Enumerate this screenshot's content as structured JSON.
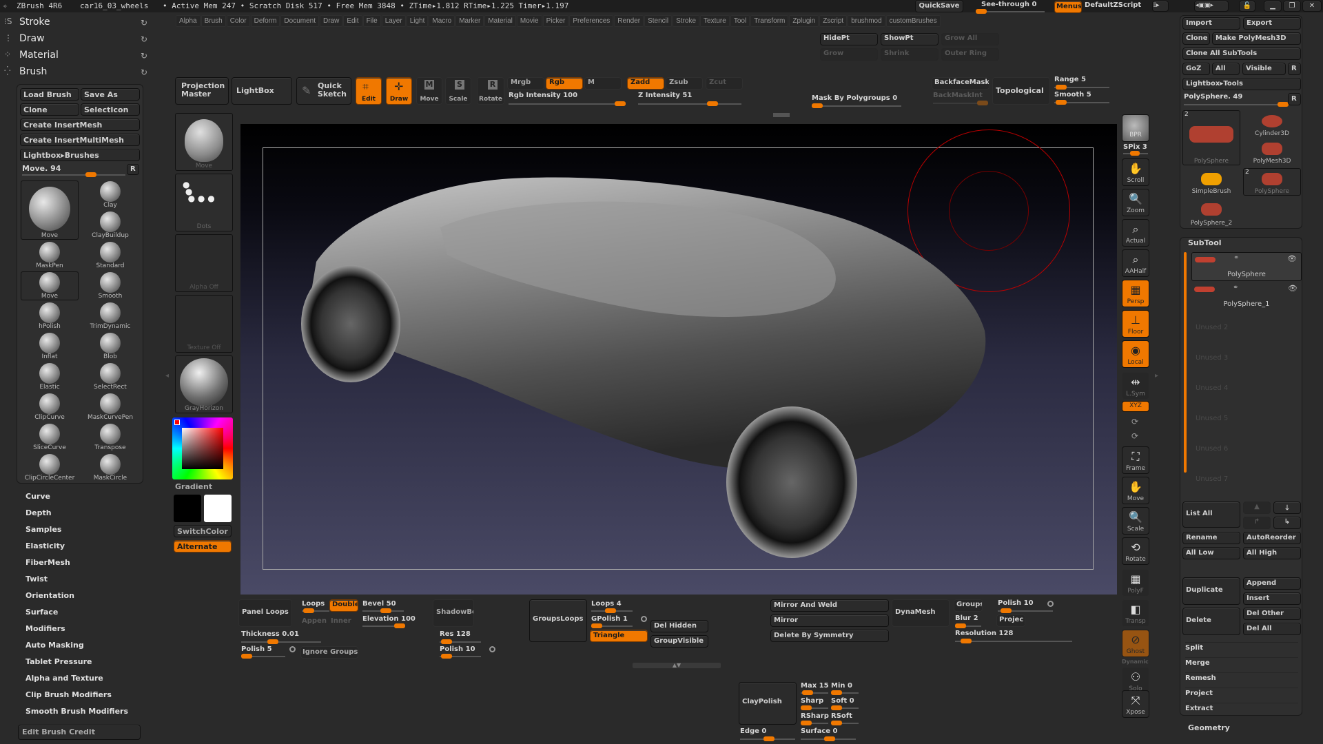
{
  "titlebar": {
    "app": "ZBrush 4R6",
    "document": "car16_03_wheels",
    "stats": "• Active Mem 247 • Scratch Disk 517 • Free Mem 3848 • ZTime▸1.812 RTime▸1.225 Timer▸1.197",
    "quicksave": "QuickSave",
    "see_through": "See-through  0",
    "menus": "Menus",
    "script": "DefaultZScript"
  },
  "menubar": [
    "Alpha",
    "Brush",
    "Color",
    "Deform",
    "Document",
    "Draw",
    "Edit",
    "File",
    "Layer",
    "Light",
    "Macro",
    "Marker",
    "Material",
    "Movie",
    "Picker",
    "Preferences",
    "Render",
    "Stencil",
    "Stroke",
    "Texture",
    "Tool",
    "Transform",
    "Zplugin",
    "Zscript",
    "brushmod",
    "customBrushes"
  ],
  "left_panel": {
    "headers": [
      "Stroke",
      "Draw",
      "Material",
      "Brush"
    ],
    "brush_buttons": {
      "load": "Load Brush",
      "save": "Save As",
      "clone": "Clone",
      "select_icon": "SelectIcon",
      "insert_mesh": "Create InsertMesh",
      "insert_multi": "Create InsertMultiMesh",
      "lightbox": "Lightbox▸Brushes"
    },
    "brush_slider": {
      "label": "Move. 94",
      "reset": "R",
      "value": 94
    },
    "brushes": [
      "Move",
      "Clay",
      "ClayBuildup",
      "MaskPen",
      "Standard",
      "Move",
      "Smooth",
      "hPolish",
      "TrimDynamic",
      "Inflat",
      "Blob",
      "Elastic",
      "SelectRect",
      "ClipCurve",
      "MaskCurvePen",
      "SliceCurve",
      "Transpose",
      "ClipCircleCenter",
      "MaskCircle"
    ],
    "sections": [
      "Curve",
      "Depth",
      "Samples",
      "Elasticity",
      "FiberMesh",
      "Twist",
      "Orientation",
      "Surface",
      "Modifiers",
      "Auto Masking",
      "Tablet Pressure",
      "Alpha and Texture",
      "Clip Brush Modifiers",
      "Smooth Brush Modifiers"
    ],
    "edit_credit": "Edit Brush Credit"
  },
  "shelf": {
    "move": "Move",
    "dots": "Dots",
    "alpha": "Alpha  Off",
    "texture": "Texture  Off",
    "material": "GrayHorizon",
    "gradient": "Gradient",
    "switch_color": "SwitchColor",
    "alternate": "Alternate",
    "main_color": "#ff0000",
    "secondary_color": "#ffffff"
  },
  "top_toolbar": {
    "projection_master": "Projection Master",
    "lightbox": "LightBox",
    "quick_sketch": "Quick Sketch",
    "edit": "Edit",
    "draw": "Draw",
    "move": "Move",
    "scale": "Scale",
    "rotate": "Rotate",
    "mrgb": "Mrgb",
    "rgb": "Rgb",
    "m": "M",
    "zadd": "Zadd",
    "zsub": "Zsub",
    "zcut": "Zcut",
    "rgb_intensity": {
      "label": "Rgb  Intensity 100",
      "value": 100
    },
    "z_intensity": {
      "label": "Z  Intensity 51",
      "value": 51
    },
    "mask_by_polygroups": {
      "label": "Mask By Polygroups 0",
      "value": 0
    },
    "hidept": "HidePt",
    "showpt": "ShowPt",
    "grow_all": "Grow All",
    "grow": "Grow",
    "shrink": "Shrink",
    "outer_ring": "Outer Ring",
    "backface_mask": "BackfaceMask",
    "backmask_int": "BackMaskInt",
    "topological": "Topological",
    "range": {
      "label": "Range 5",
      "value": 5
    },
    "smooth": {
      "label": "Smooth 5",
      "value": 5
    }
  },
  "right_toolbar": {
    "bpr": "BPR",
    "spix": "SPix 3",
    "items": [
      "Scroll",
      "Zoom",
      "Actual",
      "AAHalf",
      "Persp",
      "Floor",
      "Local",
      "L.Sym",
      "XYZ",
      "Frame",
      "Move",
      "Scale",
      "Rotate",
      "PolyF",
      "Transp",
      "Ghost",
      "Solo",
      "Xpose"
    ],
    "active": [
      "Persp",
      "Floor",
      "Local",
      "XYZ"
    ],
    "dynamic": "Dynamic"
  },
  "tool_panel": {
    "import": "Import",
    "export": "Export",
    "clone": "Clone",
    "make_polymesh": "Make PolyMesh3D",
    "clone_all": "Clone All SubTools",
    "goz": "GoZ",
    "all": "All",
    "visible": "Visible",
    "r": "R",
    "lightbox_tools": "Lightbox▸Tools",
    "tool_slider": {
      "label": "PolySphere. 49",
      "value": 49
    },
    "tools": [
      {
        "name": "PolySphere",
        "badge": "2"
      },
      {
        "name": "Cylinder3D"
      },
      {
        "name": "PolyMesh3D"
      },
      {
        "name": "SimpleBrush"
      },
      {
        "name": "PolySphere",
        "badge": "2"
      },
      {
        "name": "PolySphere_2"
      }
    ]
  },
  "subtool": {
    "title": "SubTool",
    "items": [
      "PolySphere",
      "PolySphere_1",
      "Unused  2",
      "Unused  3",
      "Unused  4",
      "Unused  5",
      "Unused  6",
      "Unused  7"
    ],
    "list_all": "List All",
    "rename": "Rename",
    "auto_reorder": "AutoReorder",
    "all_low": "All Low",
    "all_high": "All High",
    "duplicate": "Duplicate",
    "append": "Append",
    "insert": "Insert",
    "delete": "Delete",
    "del_other": "Del Other",
    "del_all": "Del All",
    "sections": [
      "Split",
      "Merge",
      "Remesh",
      "Project",
      "Extract"
    ],
    "geometry": "Geometry"
  },
  "bottom_panel": {
    "panel_loops": "Panel Loops",
    "loops": "Loops",
    "double": "Double",
    "append": "Appen",
    "inner": "Inner",
    "bevel": {
      "label": "Bevel 50",
      "value": 50
    },
    "elevation": {
      "label": "Elevation 100",
      "value": 100
    },
    "thickness": {
      "label": "Thickness 0.01",
      "value": 0.01
    },
    "polish": {
      "label": "Polish 5",
      "value": 5
    },
    "ignore_groups": "Ignore Groups",
    "shadowbox": "ShadowBox",
    "res": {
      "label": "Res 128",
      "value": 128
    },
    "sb_polish": {
      "label": "Polish 10",
      "value": 10
    },
    "groups_loops": "GroupsLoops",
    "gl_loops": {
      "label": "Loops 4",
      "value": 4
    },
    "gpolish": {
      "label": "GPolish 1",
      "value": 1
    },
    "triangle": "Triangle",
    "del_hidden": "Del Hidden",
    "group_visible": "GroupVisible",
    "mirror_weld": "Mirror And Weld",
    "mirror": "Mirror",
    "delete_sym": "Delete By Symmetry",
    "dynamesh": "DynaMesh",
    "groups": "Groups",
    "dm_polish": {
      "label": "Polish 10",
      "value": 10
    },
    "blur": {
      "label": "Blur 2",
      "value": 2
    },
    "project": "Projec",
    "resolution": {
      "label": "Resolution 128",
      "value": 128
    },
    "claypolish": "ClayPolish",
    "max": {
      "label": "Max 15",
      "value": 15
    },
    "min": {
      "label": "Min 0",
      "value": 0
    },
    "sharp": "Sharp",
    "soft": {
      "label": "Soft 0",
      "value": 0
    },
    "rsharp": "RSharp",
    "rsoft": "RSoft",
    "edge": {
      "label": "Edge 0",
      "value": 0
    },
    "surface": {
      "label": "Surface 0",
      "value": 0
    }
  }
}
